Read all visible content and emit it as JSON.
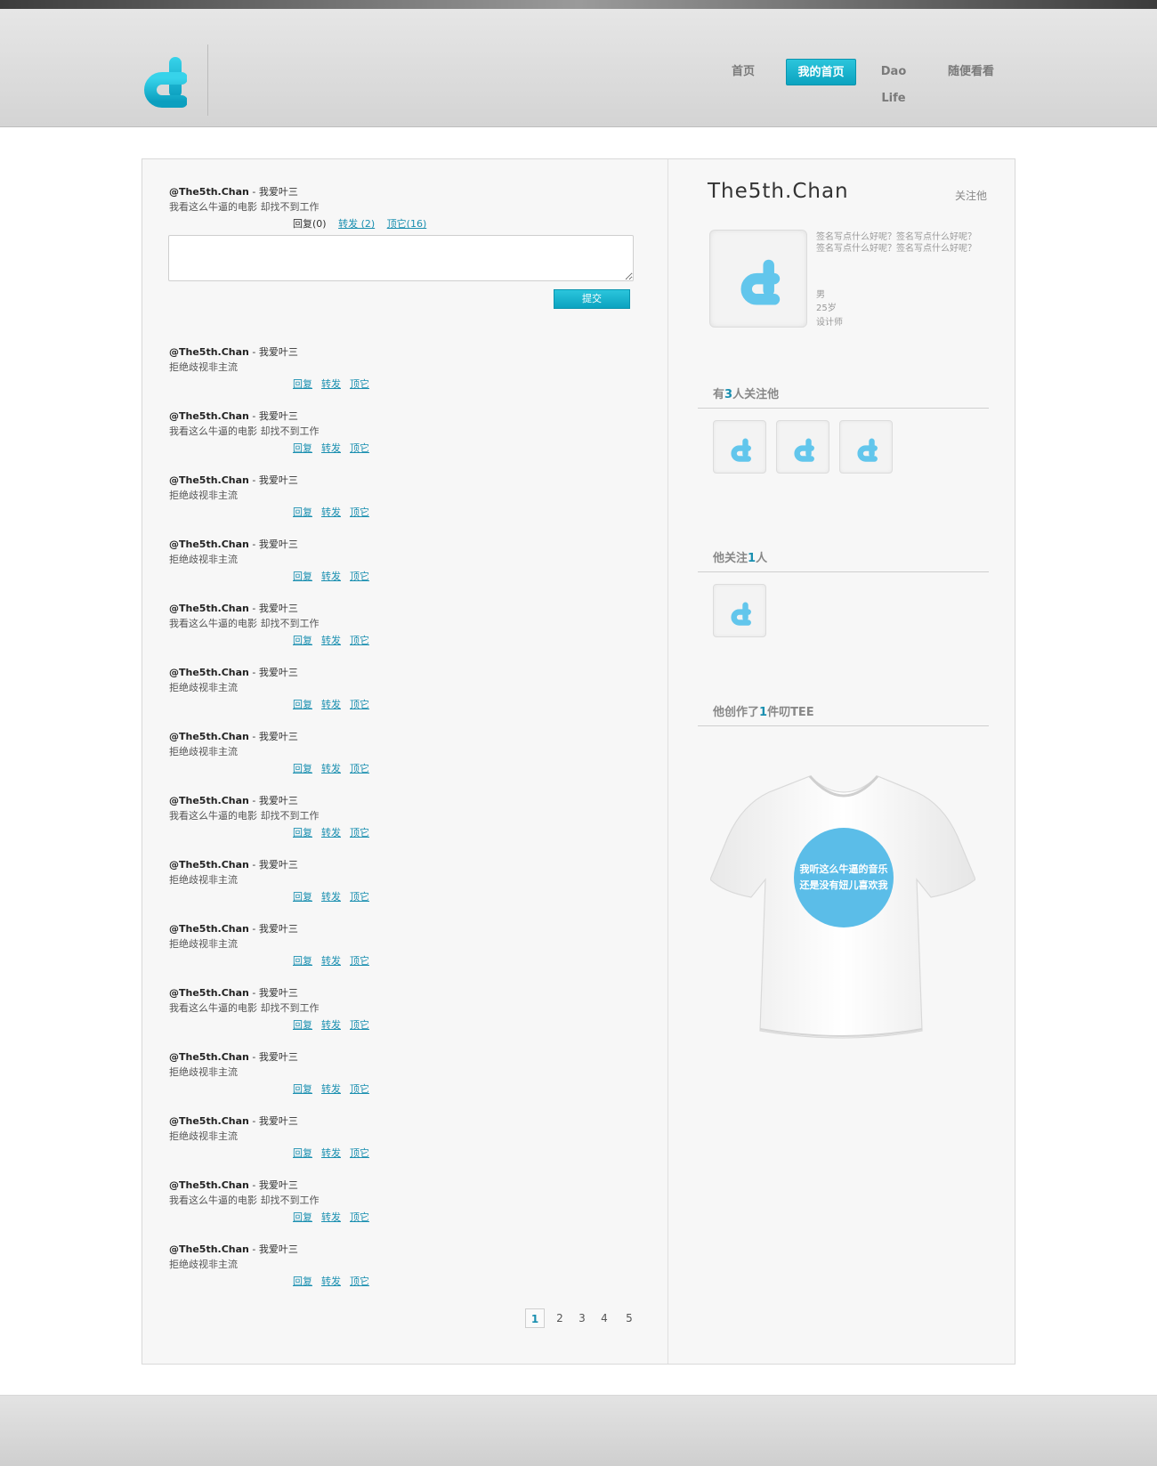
{
  "brand": {
    "accent": "#0bb0cc",
    "link": "#1a8fb0",
    "logo_icon": "d-logo-icon"
  },
  "nav": {
    "items": [
      {
        "label": "首页",
        "active": false
      },
      {
        "label": "我的首页",
        "active": true
      },
      {
        "label": "Dao Life",
        "active": false
      },
      {
        "label": "随便看看",
        "active": false
      }
    ]
  },
  "composer": {
    "post": {
      "user": "@The5th.Chan",
      "sep": " - ",
      "title": "我爱叶三",
      "text": "我看这么牛逼的电影 却找不到工作"
    },
    "reply_count_label": "回复(0)",
    "forward_label": "转发 (2)",
    "top_label": "顶它(16)",
    "submit_label": "提交"
  },
  "feed": {
    "action_reply": "回复",
    "action_forward": "转发",
    "action_top": "顶它",
    "posts": [
      {
        "user": "@The5th.Chan",
        "title": "我爱叶三",
        "text": "拒绝歧视非主流"
      },
      {
        "user": "@The5th.Chan",
        "title": "我爱叶三",
        "text": "我看这么牛逼的电影 却找不到工作"
      },
      {
        "user": "@The5th.Chan",
        "title": "我爱叶三",
        "text": "拒绝歧视非主流"
      },
      {
        "user": "@The5th.Chan",
        "title": "我爱叶三",
        "text": "拒绝歧视非主流"
      },
      {
        "user": "@The5th.Chan",
        "title": "我爱叶三",
        "text": "我看这么牛逼的电影 却找不到工作"
      },
      {
        "user": "@The5th.Chan",
        "title": "我爱叶三",
        "text": "拒绝歧视非主流"
      },
      {
        "user": "@The5th.Chan",
        "title": "我爱叶三",
        "text": "拒绝歧视非主流"
      },
      {
        "user": "@The5th.Chan",
        "title": "我爱叶三",
        "text": "我看这么牛逼的电影 却找不到工作"
      },
      {
        "user": "@The5th.Chan",
        "title": "我爱叶三",
        "text": "拒绝歧视非主流"
      },
      {
        "user": "@The5th.Chan",
        "title": "我爱叶三",
        "text": "拒绝歧视非主流"
      },
      {
        "user": "@The5th.Chan",
        "title": "我爱叶三",
        "text": "我看这么牛逼的电影 却找不到工作"
      },
      {
        "user": "@The5th.Chan",
        "title": "我爱叶三",
        "text": "拒绝歧视非主流"
      },
      {
        "user": "@The5th.Chan",
        "title": "我爱叶三",
        "text": "拒绝歧视非主流"
      },
      {
        "user": "@The5th.Chan",
        "title": "我爱叶三",
        "text": "我看这么牛逼的电影 却找不到工作"
      },
      {
        "user": "@The5th.Chan",
        "title": "我爱叶三",
        "text": "拒绝歧视非主流"
      }
    ]
  },
  "pagination": {
    "pages": [
      "1",
      "2",
      "3",
      "4",
      "5"
    ],
    "current": "1"
  },
  "profile": {
    "name": "The5th.Chan",
    "follow_label": "关注他",
    "signature_line1": "签名写点什么好呢？签名写点什么好呢？",
    "signature_line2": "签名写点什么好呢？签名写点什么好呢？",
    "gender": "男",
    "age": "25岁",
    "job": "设计师"
  },
  "followers": {
    "prefix": "有",
    "count": "3",
    "suffix": "人关注他"
  },
  "following": {
    "prefix": "他关注",
    "count": "1",
    "suffix": "人"
  },
  "tees": {
    "prefix": "他创作了",
    "count": "1",
    "suffix": "件叨TEE",
    "print_line1": "我听这么牛逼的音乐",
    "print_line2": "还是没有妞儿喜欢我",
    "print_color": "#5bbde8"
  }
}
